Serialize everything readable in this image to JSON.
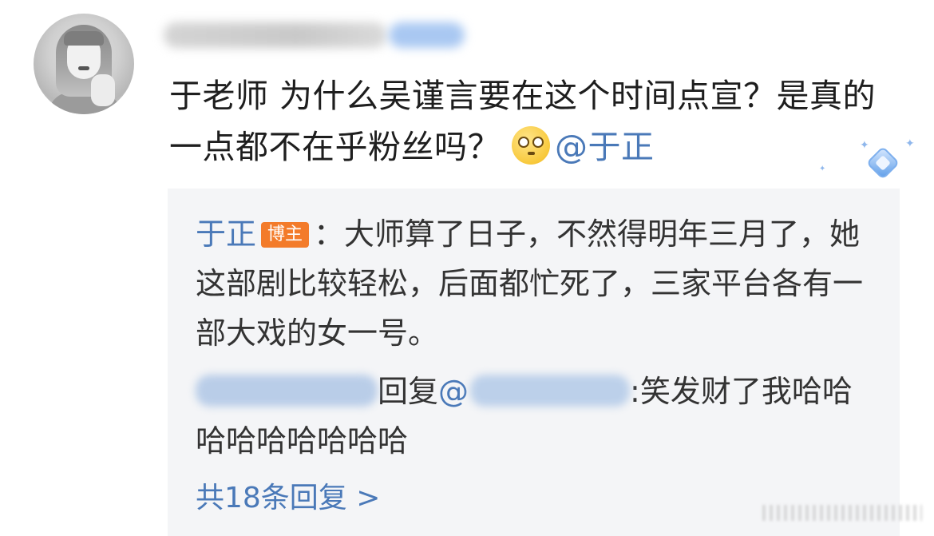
{
  "post": {
    "comment_text": "于老师 为什么吴谨言要在这个时间点宣？是真的一点都不在乎粉丝吗？",
    "mention": "@于正"
  },
  "reply_thread": {
    "reply1": {
      "author": "于正",
      "tag": "博主",
      "separator": "：",
      "text": "大师算了日子，不然得明年三月了，她这部剧比较轻松，后面都忙死了，三家平台各有一部大戏的女一号。"
    },
    "reply2": {
      "action": "回复",
      "at": "@",
      "text": ":笑发财了我哈哈哈哈哈哈哈哈哈"
    },
    "more_replies": "共18条回复 >"
  },
  "icons": {
    "emoji": "rolling-eyes-emoji-icon",
    "badge": "diamond-badge-icon"
  },
  "colors": {
    "link_blue": "#4a79b8",
    "tag_orange": "#f37b2a",
    "reply_bg": "#f4f5f7"
  }
}
